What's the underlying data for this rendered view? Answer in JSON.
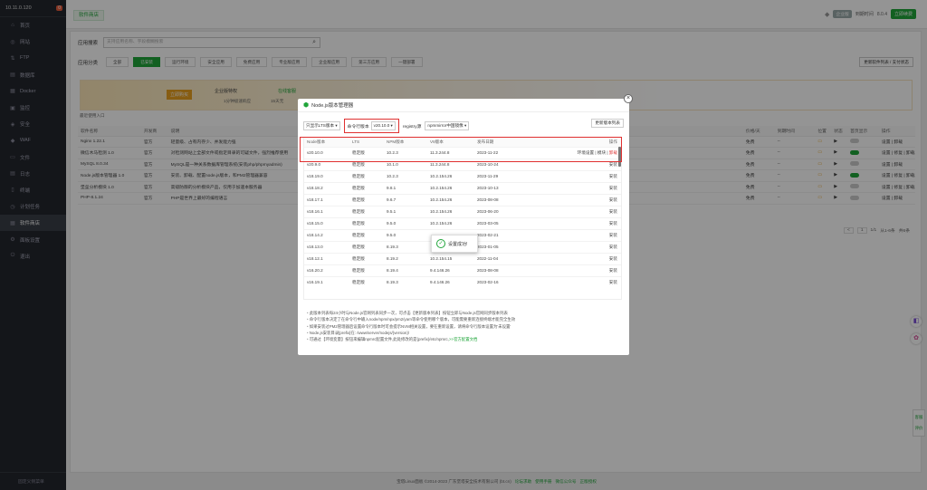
{
  "sidebar": {
    "server": "10.11.0.120",
    "badge": "0",
    "items": [
      {
        "icon": "home-icon",
        "label": "首页",
        "glyph": "⌂"
      },
      {
        "icon": "globe-icon",
        "label": "网站",
        "glyph": "◎"
      },
      {
        "icon": "ftp-icon",
        "label": "FTP",
        "glyph": "⇅"
      },
      {
        "icon": "database-icon",
        "label": "数据库",
        "glyph": "▤"
      },
      {
        "icon": "docker-icon",
        "label": "Docker",
        "glyph": "▦"
      },
      {
        "icon": "monitor-icon",
        "label": "监控",
        "glyph": "▣"
      },
      {
        "icon": "shield-icon",
        "label": "安全",
        "glyph": "◈"
      },
      {
        "icon": "waf-icon",
        "label": "WAF",
        "glyph": "◆"
      },
      {
        "icon": "folder-icon",
        "label": "文件",
        "glyph": "▭"
      },
      {
        "icon": "log-icon",
        "label": "日志",
        "glyph": "▤"
      },
      {
        "icon": "terminal-icon",
        "label": "终端",
        "glyph": "▯"
      },
      {
        "icon": "clock-icon",
        "label": "计划任务",
        "glyph": "◷"
      },
      {
        "icon": "grid-icon",
        "label": "软件商店",
        "glyph": "▦"
      },
      {
        "icon": "gear-icon",
        "label": "面板设置",
        "glyph": "⚙"
      },
      {
        "icon": "exit-icon",
        "label": "退出",
        "glyph": "⏻"
      }
    ],
    "active_index": 12,
    "footer": "固定父侧菜单"
  },
  "topbar": {
    "tab": "软件商店",
    "ent": "企业版",
    "expire": "到期时间",
    "version": "8.0.4",
    "buy": "立即续费"
  },
  "main": {
    "search_label": "应用搜索",
    "search_placeholder": "支持应用名称、字段模糊搜索",
    "cat_label": "应用分类",
    "cats": [
      "全部",
      "已安装",
      "运行环境",
      "安全应用",
      "免费应用",
      "专业版应用",
      "企业版应用",
      "第三方应用",
      "一键部署"
    ],
    "cat_active": 1,
    "update_btn": "更新软件列表 / 支付状态",
    "banner": {
      "btn": "立即购买",
      "t1": "企业版特权",
      "t2": "1分钟极速响应",
      "t3": "15天无",
      "t4": "在线客服",
      "t5": "(以上)"
    },
    "recent": "最近使用入口",
    "headers": [
      "软件名称",
      "开发商",
      "说明",
      "",
      "",
      "",
      "价格/天",
      "到期时间",
      "位置",
      "状态",
      "首页显示",
      "操作"
    ],
    "rows": [
      {
        "name": "Nginx 1.22.1",
        "dev": "官方",
        "desc": "轻量级、占有内存少、并发能力强",
        "price": "免费",
        "exp": "--",
        "on": false,
        "ops": "设置 | 卸载"
      },
      {
        "name": "微信木马检测 1.0",
        "dev": "官方",
        "desc": "对检测网站上全部文件或指定目录的可疑文件，强烈推荐使用",
        "price": "免费",
        "exp": "--",
        "on": true,
        "ops": "设置 | 修复 | 卸载"
      },
      {
        "name": "MySQL 8.0.34",
        "dev": "官方",
        "desc": "MySQL是一种关系数据库管理系统(安装php/phpmyadmin)",
        "price": "免费",
        "exp": "--",
        "on": false,
        "ops": "设置 | 卸载"
      },
      {
        "name": "Node.js版本管理器 1.0",
        "dev": "官方",
        "desc": "安装、卸载、配置node.js版本，和PM2管理器兼容",
        "price": "免费",
        "exp": "--",
        "on": true,
        "ops": "设置 | 修复 | 卸载"
      },
      {
        "name": "堡垒分析模块 1.0",
        "dev": "官方",
        "desc": "高级防御的分析模块产品，仅用于加速本服务器",
        "price": "免费",
        "exp": "--",
        "on": false,
        "ops": "设置 | 修复 | 卸载"
      },
      {
        "name": "PHP-8.1.24",
        "dev": "官方",
        "desc": "PHP是世界上最好的编程语言",
        "price": "免费",
        "exp": "--",
        "on": false,
        "ops": "设置 | 卸载"
      }
    ],
    "pager": {
      "prev": "<",
      "page": "1",
      "total": "1/1",
      "range": "从1-6条",
      "count": "共6条"
    }
  },
  "footer": {
    "text": "宝塔Linux面板 ©2014-2023 广东堡塔安全技术有限公司 (bt.cn)",
    "links": [
      "论坛求助",
      "使用手册",
      "微信公众号",
      "正版授权"
    ]
  },
  "side_tabs": [
    "客服",
    "评价"
  ],
  "modal": {
    "title": "Node.js版本管理器",
    "filter_lts": "只显示LTS版本",
    "cmd_label": "命令行版本",
    "cmd_value": "v20.10.0",
    "registry_label": "registry源",
    "registry_value": "npmmirror中国镜像",
    "refresh": "更新版本列表",
    "headers": [
      "Node版本",
      "LTS",
      "NPM版本",
      "V8版本",
      "发布日期",
      "操作"
    ],
    "rows": [
      {
        "v": "v20.10.0",
        "lts": "稳定版",
        "npm": "10.2.3",
        "v8": "11.3.244.8",
        "date": "2023-11-22",
        "ops": "环境设置 | 模块 | 卸载"
      },
      {
        "v": "v20.9.0",
        "lts": "稳定版",
        "npm": "10.1.0",
        "v8": "11.3.244.8",
        "date": "2023-10-24",
        "ops": "安装"
      },
      {
        "v": "v18.19.0",
        "lts": "稳定版",
        "npm": "10.2.3",
        "v8": "10.2.154.26",
        "date": "2023-11-29",
        "ops": "安装"
      },
      {
        "v": "v18.18.2",
        "lts": "稳定版",
        "npm": "9.8.1",
        "v8": "10.2.154.26",
        "date": "2023-10-13",
        "ops": "安装"
      },
      {
        "v": "v18.17.1",
        "lts": "稳定版",
        "npm": "9.6.7",
        "v8": "10.2.154.26",
        "date": "2023-08-08",
        "ops": "安装"
      },
      {
        "v": "v18.16.1",
        "lts": "稳定版",
        "npm": "9.5.1",
        "v8": "10.2.154.26",
        "date": "2023-06-20",
        "ops": "安装"
      },
      {
        "v": "v18.15.0",
        "lts": "稳定版",
        "npm": "9.5.0",
        "v8": "10.2.154.26",
        "date": "2023-03-05",
        "ops": "安装"
      },
      {
        "v": "v18.14.2",
        "lts": "稳定版",
        "npm": "9.5.0",
        "v8": "",
        "date": "2023-02-21",
        "ops": "安装"
      },
      {
        "v": "v18.13.0",
        "lts": "稳定版",
        "npm": "8.19.3",
        "v8": "",
        "date": "2023-01-05",
        "ops": "安装"
      },
      {
        "v": "v18.12.1",
        "lts": "稳定版",
        "npm": "8.19.2",
        "v8": "10.2.154.15",
        "date": "2022-11-04",
        "ops": "安装"
      },
      {
        "v": "v16.20.2",
        "lts": "稳定版",
        "npm": "8.19.4",
        "v8": "9.4.146.26",
        "date": "2023-08-08",
        "ops": "安装"
      },
      {
        "v": "v16.19.1",
        "lts": "稳定版",
        "npm": "8.19.3",
        "v8": "9.4.146.26",
        "date": "2023-02-16",
        "ops": "安装"
      }
    ],
    "notes": [
      "此版本列表每24小时与Node.js官网列表同步一次，可点击【更新版本列表】按钮立即与Node.js官网同步版本列表",
      "命令行版本决定了在命令行中输入node/npm/npx/pm2/yarn等命令使用哪个版本，可能需要重新连接终端才能完全生效",
      "如果安装过PM2管理器后设置命令行版本时可会提示NVM相关设置，要在重新设置，请将命令行版本设置为'未设置'",
      "Node.js安装目录[prefix]在: /www/server/nodejs/{version}/",
      "可通过【环境变量】按钮来编辑npmrc配置文件,此处修改的是{prefix}/etc/npmrc,"
    ],
    "notes_link": ">>官方配置文档",
    "toast": "设置成功!"
  },
  "colors": {
    "accent": "#20a53a",
    "danger": "#e03030",
    "sidebar": "#23272e"
  }
}
